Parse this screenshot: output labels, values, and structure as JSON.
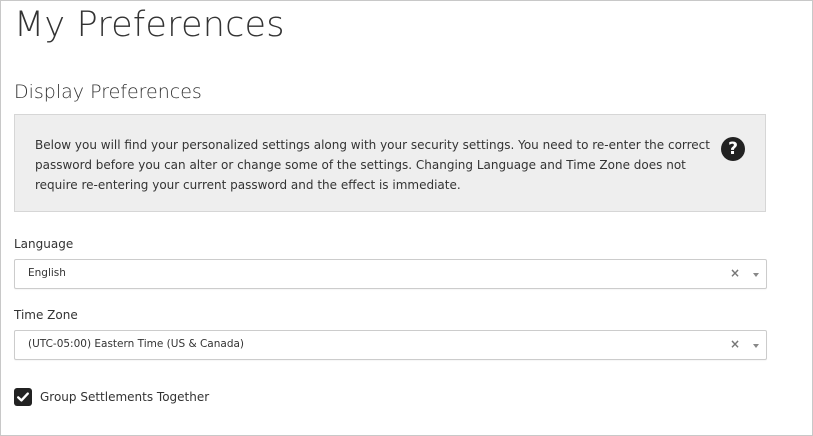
{
  "page": {
    "title": "My Preferences"
  },
  "display_preferences": {
    "section_title": "Display Preferences",
    "info_text": "Below you will find your personalized settings along with your security settings. You need to re-enter the correct password before you can alter or change some of the settings. Changing Language and Time Zone does not require re-entering your current password and the effect is immediate.",
    "help_icon": "question-circle-icon",
    "help_glyph": "?"
  },
  "language": {
    "label": "Language",
    "selected": "English",
    "clear_glyph": "×"
  },
  "time_zone": {
    "label": "Time Zone",
    "selected": "(UTC-05:00) Eastern Time (US & Canada)",
    "clear_glyph": "×"
  },
  "group_settlements": {
    "label": "Group Settlements Together",
    "checked": true
  },
  "colors": {
    "info_box_bg": "#eeeeee",
    "checkbox_fill": "#222222",
    "help_icon_fill": "#222222"
  }
}
